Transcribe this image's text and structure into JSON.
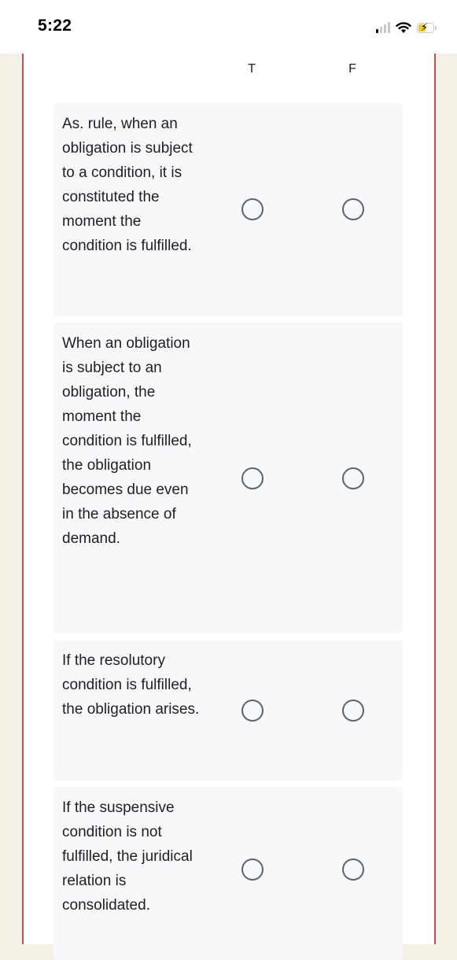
{
  "status_bar": {
    "time": "5:22",
    "icons": [
      "cellular-signal-icon",
      "wifi-icon",
      "battery-charging-icon"
    ],
    "battery_color": "#f5c518"
  },
  "colors": {
    "page_background": "#f6f1e7",
    "panel_border": "#c5504c",
    "card_background": "#f7f8fa",
    "radio_stroke": "#5f6368"
  },
  "grid": {
    "columns": [
      {
        "label": "T"
      },
      {
        "label": "F"
      }
    ],
    "rows": [
      {
        "statement": "As. rule, when an obligation is subject to a condition, it is constituted the moment the condition is fulfilled.",
        "selected": null
      },
      {
        "statement": "When an obligation is subject to an obligation, the moment the condition is fulfilled, the obligation becomes due even in the absence of demand.",
        "selected": null
      },
      {
        "statement": "If the resolutory condition is fulfilled, the obligation arises.",
        "selected": null
      },
      {
        "statement": "If the suspensive condition is not fulfilled, the juridical relation is consolidated.",
        "selected": null
      }
    ]
  }
}
